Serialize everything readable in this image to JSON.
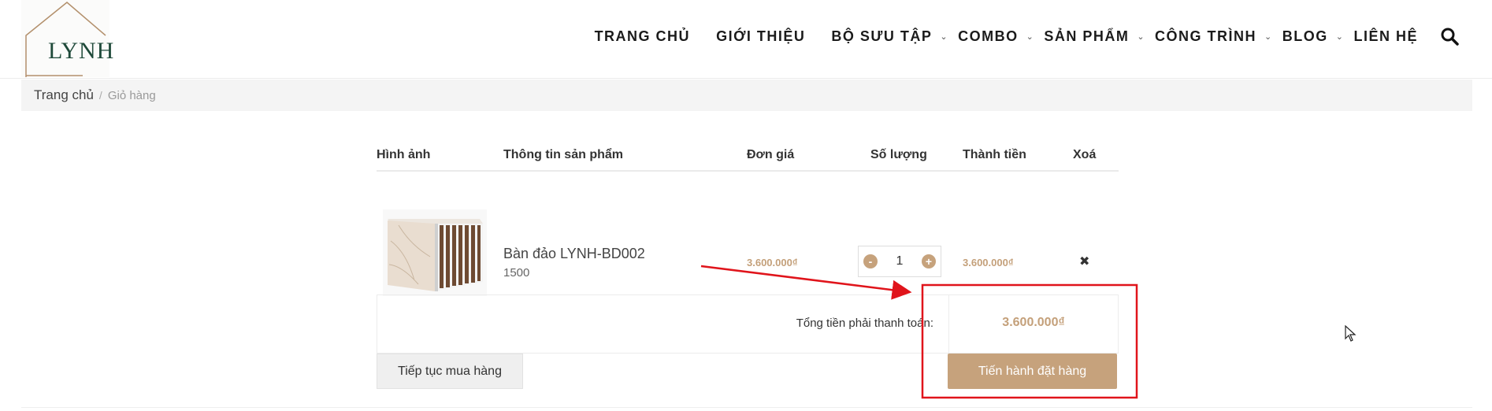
{
  "header": {
    "logo_text": "LYNH",
    "nav": [
      {
        "label": "TRANG CHỦ",
        "has_sub": false
      },
      {
        "label": "GIỚI THIỆU",
        "has_sub": false
      },
      {
        "label": "BỘ SƯU TẬP",
        "has_sub": true
      },
      {
        "label": "COMBO",
        "has_sub": true
      },
      {
        "label": "SẢN PHẨM",
        "has_sub": true
      },
      {
        "label": "CÔNG TRÌNH",
        "has_sub": true
      },
      {
        "label": "BLOG",
        "has_sub": true
      },
      {
        "label": "LIÊN HỆ",
        "has_sub": false
      }
    ],
    "chevron": "⌄"
  },
  "breadcrumb": {
    "home": "Trang chủ",
    "separator": "/",
    "current": "Giỏ hàng"
  },
  "cart": {
    "headers": {
      "image": "Hình ảnh",
      "info": "Thông tin sản phẩm",
      "unit_price": "Đơn giá",
      "quantity": "Số lượng",
      "line_total": "Thành tiền",
      "remove": "Xoá"
    },
    "items": [
      {
        "name": "Bàn đảo LYNH-BD002",
        "variant": "1500",
        "unit_price": "3.600.000₫",
        "quantity": "1",
        "line_total": "3.600.000₫"
      }
    ],
    "qty_minus": "-",
    "qty_plus": "+",
    "remove_icon": "✖",
    "total_label": "Tổng tiền phải thanh toán:",
    "total_value": "3.600.000₫",
    "continue_label": "Tiếp tục mua hàng",
    "checkout_label": "Tiến hành đặt hàng"
  },
  "colors": {
    "accent": "#c6a27c",
    "price": "#c4a07a",
    "annotation": "#e0141b"
  }
}
